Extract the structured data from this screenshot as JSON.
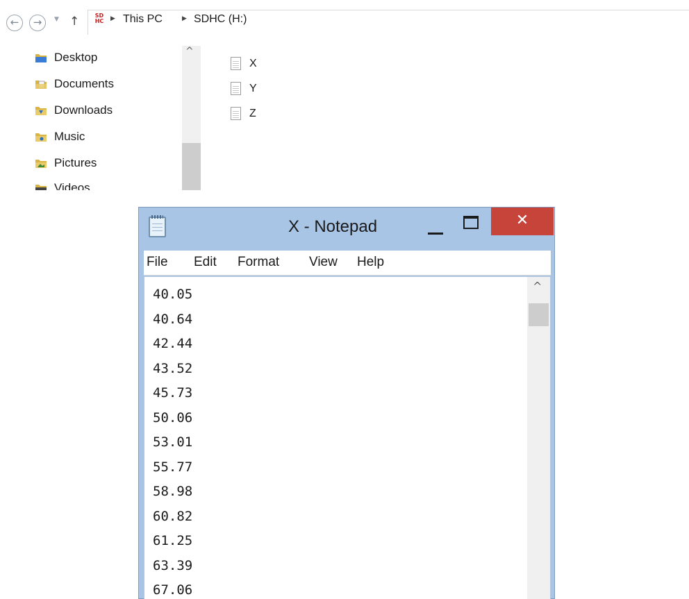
{
  "explorer": {
    "nav_glyphs": {
      "back": "←",
      "forward": "→",
      "recent": "▼",
      "up": "↑"
    },
    "address": {
      "drive_icon_text_top": "SD",
      "drive_icon_text_bottom": "HC",
      "separator": "▶",
      "crumbs": [
        "This PC",
        "SDHC (H:)"
      ]
    },
    "nav_pane": {
      "items": [
        {
          "label": "Desktop",
          "icon": "desktop-folder-icon",
          "color": "#3a7bd5"
        },
        {
          "label": "Documents",
          "icon": "documents-folder-icon",
          "color": "#e8c25a"
        },
        {
          "label": "Downloads",
          "icon": "downloads-folder-icon",
          "color": "#e8c25a"
        },
        {
          "label": "Music",
          "icon": "music-folder-icon",
          "color": "#e8c25a"
        },
        {
          "label": "Pictures",
          "icon": "pictures-folder-icon",
          "color": "#e8c25a"
        },
        {
          "label": "Videos",
          "icon": "videos-folder-icon",
          "color": "#e8c25a"
        }
      ],
      "scroll_up_glyph": "^"
    },
    "files": [
      {
        "name": "X",
        "icon": "text-file-icon"
      },
      {
        "name": "Y",
        "icon": "text-file-icon"
      },
      {
        "name": "Z",
        "icon": "text-file-icon"
      }
    ]
  },
  "notepad": {
    "title": "X - Notepad",
    "close_glyph": "✕",
    "menu": [
      "File",
      "Edit",
      "Format",
      "View",
      "Help"
    ],
    "lines": [
      "40.05",
      "40.64",
      "42.44",
      "43.52",
      "45.73",
      "50.06",
      "53.01",
      "55.77",
      "58.98",
      "60.82",
      "61.25",
      "63.39",
      "67.06"
    ],
    "scroll_up_glyph": "^",
    "colors": {
      "frame": "#a9c5e6",
      "close": "#c7443b"
    }
  }
}
